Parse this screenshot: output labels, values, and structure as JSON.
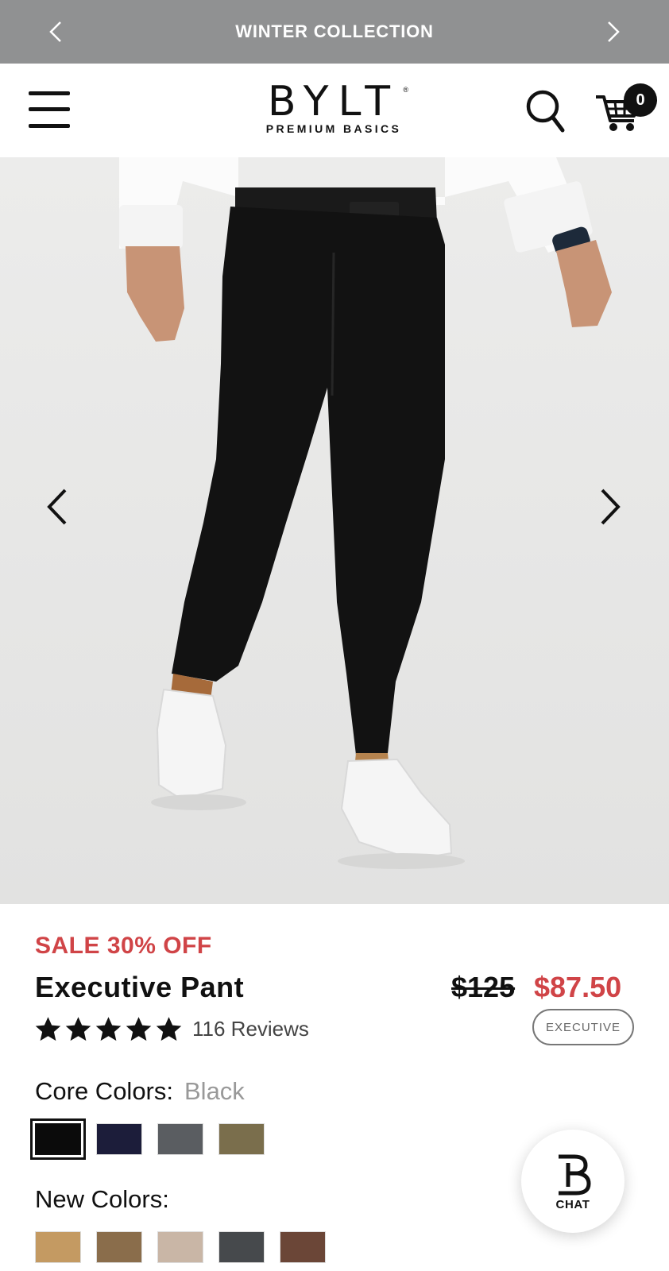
{
  "announcement": {
    "title": "WINTER COLLECTION"
  },
  "header": {
    "logo_word": "BYLT",
    "logo_reg": "®",
    "logo_tagline": "PREMIUM BASICS",
    "cart_count": "0"
  },
  "product": {
    "sale_label": "SALE 30% OFF",
    "name": "Executive Pant",
    "price_original": "$125",
    "price_sale": "$87.50",
    "rating": 5,
    "reviews": "116 Reviews",
    "fit_tag": "EXECUTIVE"
  },
  "core_colors": {
    "label": "Core Colors:",
    "selected_name": "Black",
    "swatches": [
      "#0b0b0b",
      "#1c1d3a",
      "#5a5d61",
      "#7a6e4c"
    ],
    "selected_index": 0
  },
  "new_colors": {
    "label": "New Colors:",
    "swatches": [
      "#c49a62",
      "#8a6d4b",
      "#c9b6a6",
      "#46494c",
      "#6b4637"
    ]
  },
  "chat": {
    "label": "CHAT"
  },
  "colors": {
    "accent_red": "#d04447",
    "banner_gray": "#909192"
  },
  "icons": [
    "chevron-left-icon",
    "chevron-right-icon",
    "menu-icon",
    "search-icon",
    "cart-icon",
    "star-icon",
    "chat-logo-icon"
  ]
}
